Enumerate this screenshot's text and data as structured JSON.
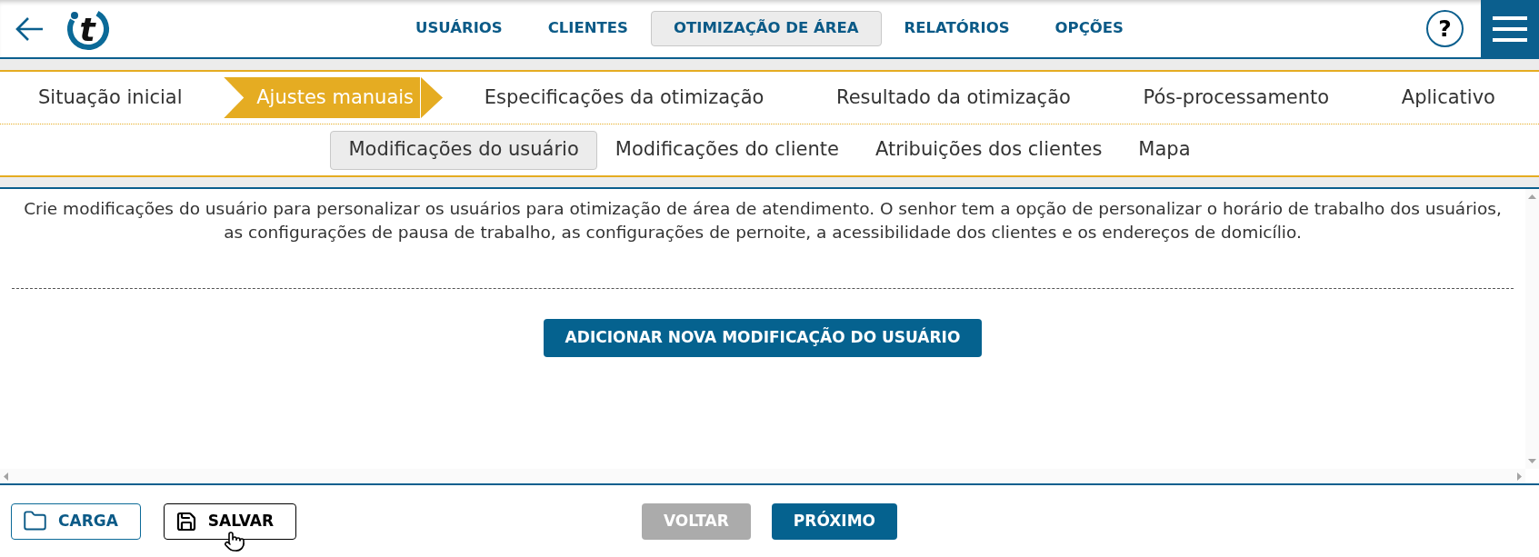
{
  "header": {
    "logo_text": "t",
    "nav": [
      {
        "label": "USUÁRIOS",
        "selected": false
      },
      {
        "label": "CLIENTES",
        "selected": false
      },
      {
        "label": "OTIMIZAÇÃO DE ÁREA",
        "selected": true
      },
      {
        "label": "RELATÓRIOS",
        "selected": false
      },
      {
        "label": "OPÇÕES",
        "selected": false
      }
    ],
    "help_label": "?"
  },
  "steps": [
    {
      "label": "Situação inicial",
      "selected": false
    },
    {
      "label": "Ajustes manuais",
      "selected": true
    },
    {
      "label": "Especificações da otimização",
      "selected": false
    },
    {
      "label": "Resultado da otimização",
      "selected": false
    },
    {
      "label": "Pós-processamento",
      "selected": false
    },
    {
      "label": "Aplicativo",
      "selected": false
    }
  ],
  "subtabs": [
    {
      "label": "Modificações do usuário",
      "selected": true
    },
    {
      "label": "Modificações do cliente",
      "selected": false
    },
    {
      "label": "Atribuições dos clientes",
      "selected": false
    },
    {
      "label": "Mapa",
      "selected": false
    }
  ],
  "content": {
    "description": "Crie modificações do usuário para personalizar os usuários para otimização de área de atendimento. O senhor tem a opção de personalizar o horário de trabalho dos usuários, as configurações de pausa de trabalho, as configurações de pernoite, a acessibilidade dos clientes e os endereços de domicílio.",
    "add_button": "ADICIONAR NOVA MODIFICAÇÃO DO USUÁRIO"
  },
  "footer": {
    "file_buttons": [
      {
        "kind": "load",
        "label": "CARGA",
        "hovered": false
      },
      {
        "kind": "save",
        "label": "SALVAR",
        "hovered": true
      }
    ],
    "nav_buttons": [
      {
        "label": "VOLTAR",
        "disabled": true
      },
      {
        "label": "PRÓXIMO",
        "disabled": false
      }
    ]
  }
}
